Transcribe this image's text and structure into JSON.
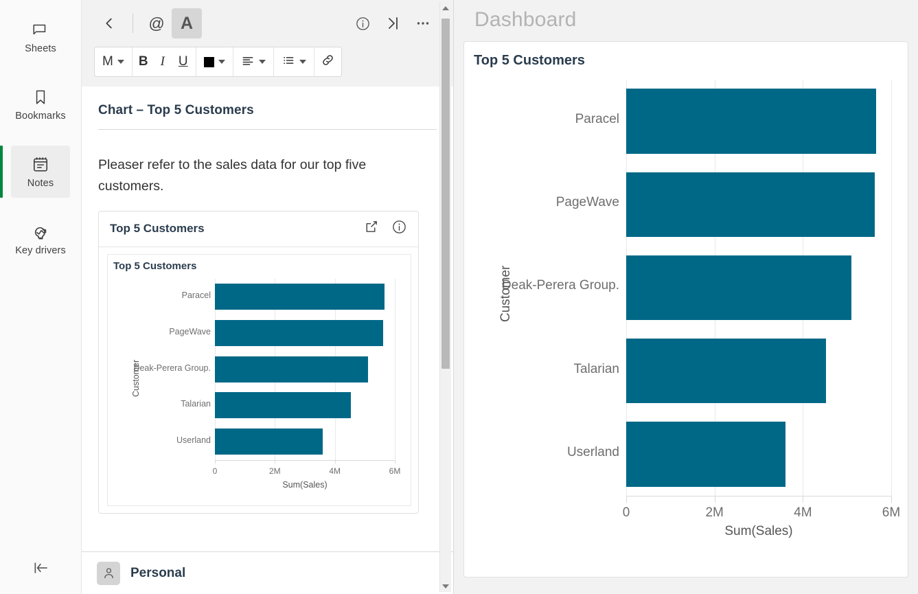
{
  "rail": {
    "items": [
      {
        "label": "Sheets",
        "icon": "sheets-icon"
      },
      {
        "label": "Bookmarks",
        "icon": "bookmark-icon"
      },
      {
        "label": "Notes",
        "icon": "notes-icon",
        "active": true
      },
      {
        "label": "Key drivers",
        "icon": "key-drivers-icon"
      }
    ],
    "collapse_icon": "collapse-panel-icon"
  },
  "notes": {
    "toolbar": {
      "back_icon": "chevron-left-icon",
      "mention_label": "@",
      "text_format_label": "A",
      "info_icon": "info-circle-icon",
      "expand_icon": "collapse-right-icon",
      "more_icon": "ellipsis-icon"
    },
    "format_bar": {
      "style_label": "M",
      "bold_label": "B",
      "italic_label": "I",
      "underline_label": "U",
      "color_swatch": "#000000",
      "align_icon": "align-left-icon",
      "list_icon": "bullet-list-icon",
      "link_icon": "link-icon"
    },
    "title": "Chart – Top 5 Customers",
    "paragraph": "Pleaser refer to the sales data for our top five customers.",
    "embedded_card": {
      "title": "Top 5 Customers",
      "share_icon": "share-export-icon",
      "info_icon": "info-circle-icon"
    },
    "footer": {
      "avatar_icon": "user-avatar-icon",
      "name": "Personal"
    }
  },
  "dashboard": {
    "title": "Dashboard",
    "card_title": "Top 5 Customers"
  },
  "colors": {
    "bar": "#006887",
    "accent_green": "#00873d",
    "panel_bg": "#f2f2f2",
    "rail_bg": "#fafafa"
  },
  "chart_data": [
    {
      "id": "embedded-chart",
      "type": "bar",
      "orientation": "horizontal",
      "title": "Top 5 Customers",
      "categories": [
        "Paracel",
        "PageWave",
        "Deak-Perera Group.",
        "Talarian",
        "Userland"
      ],
      "values": [
        5660000,
        5620000,
        5100000,
        4530000,
        3600000
      ],
      "xlabel": "Sum(Sales)",
      "ylabel": "Customer",
      "xlim": [
        0,
        6000000
      ],
      "xticks": [
        0,
        2000000,
        4000000,
        6000000
      ],
      "xticklabels": [
        "0",
        "2M",
        "4M",
        "6M"
      ],
      "grid": true,
      "legend": "none",
      "series_color": "#006887"
    },
    {
      "id": "dashboard-chart",
      "type": "bar",
      "orientation": "horizontal",
      "title": "Top 5 Customers",
      "categories": [
        "Paracel",
        "PageWave",
        "Deak-Perera Group.",
        "Talarian",
        "Userland"
      ],
      "values": [
        5660000,
        5620000,
        5100000,
        4530000,
        3600000
      ],
      "xlabel": "Sum(Sales)",
      "ylabel": "Customer",
      "xlim": [
        0,
        6000000
      ],
      "xticks": [
        0,
        2000000,
        4000000,
        6000000
      ],
      "xticklabels": [
        "0",
        "2M",
        "4M",
        "6M"
      ],
      "grid": true,
      "legend": "none",
      "series_color": "#006887"
    }
  ]
}
